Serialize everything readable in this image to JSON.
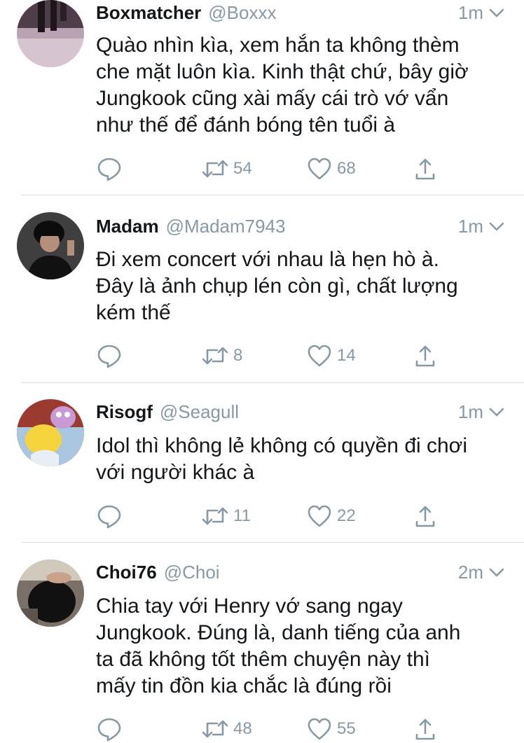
{
  "tweets": [
    {
      "name": "Boxmatcher",
      "handle": "@Boxxx",
      "time": "1m",
      "lines": [
        "Quào nhìn kìa, xem hắn ta không thèm",
        "che mặt luôn kìa. Kinh thật chứ, bây giờ",
        "Jungkook cũng xài mấy cái trò vớ vẩn",
        "như thế để đánh bóng tên tuổi à"
      ],
      "retweets": "54",
      "likes": "68"
    },
    {
      "name": "Madam",
      "handle": "@Madam7943",
      "time": "1m",
      "lines": [
        "Đi xem concert với nhau là hẹn hò à.",
        "Đây là ảnh chụp lén còn gì, chất lượng",
        "kém thế"
      ],
      "retweets": "8",
      "likes": "14"
    },
    {
      "name": "Risogf",
      "handle": "@Seagull",
      "time": "1m",
      "lines": [
        "Idol thì không lẻ không có quyền đi chơi",
        "với người khác à"
      ],
      "retweets": "11",
      "likes": "22"
    },
    {
      "name": "Choi76",
      "handle": "@Choi",
      "time": "2m",
      "lines": [
        "Chia tay với Henry vớ sang ngay",
        "Jungkook. Đúng là, danh tiếng của anh",
        "ta đã không tốt thêm chuyện này thì",
        "mấy tin đồn kia chắc là đúng rồi"
      ],
      "retweets": "48",
      "likes": "55"
    }
  ],
  "icons": {
    "reply": "reply-icon",
    "retweet": "retweet-icon",
    "like": "heart-icon",
    "share": "share-icon",
    "more": "chevron-down-icon"
  },
  "colors": {
    "muted": "#8899a6",
    "text": "#14171a",
    "divider": "#d8dde2"
  }
}
